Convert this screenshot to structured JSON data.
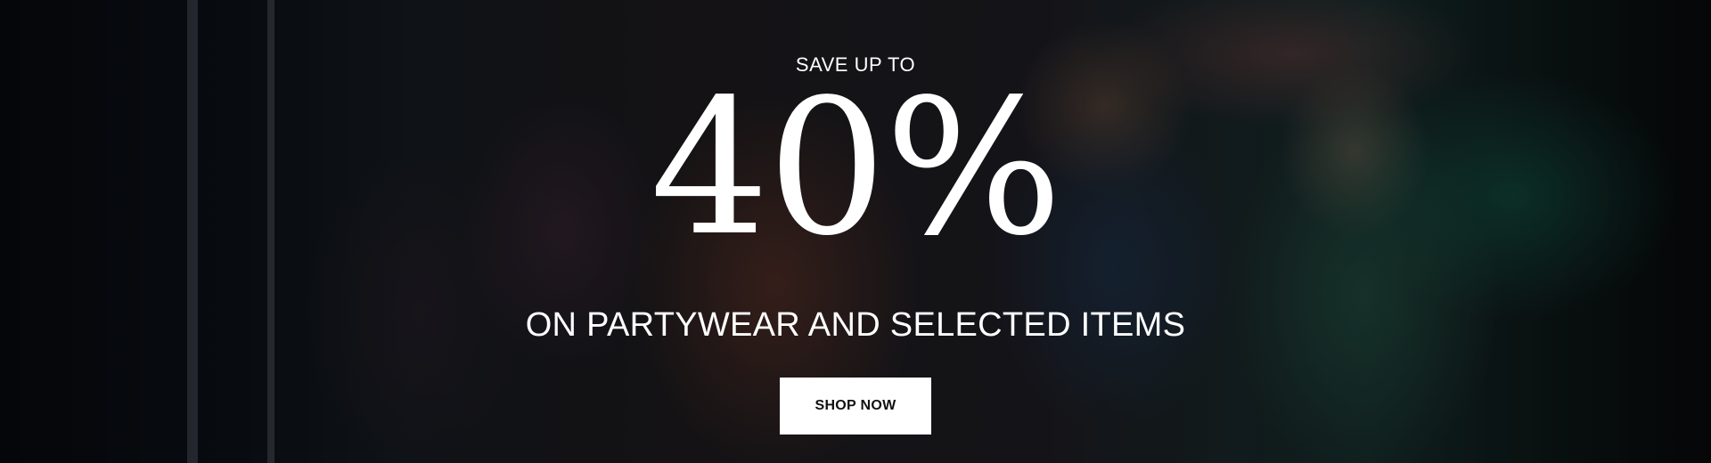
{
  "promo": {
    "kicker": "SAVE UP TO",
    "headline": "40%",
    "subline": "ON PARTYWEAR AND SELECTED ITEMS",
    "cta_label": "SHOP NOW"
  },
  "colors": {
    "text": "#ffffff",
    "button_background": "#ffffff",
    "button_text": "#111111"
  }
}
